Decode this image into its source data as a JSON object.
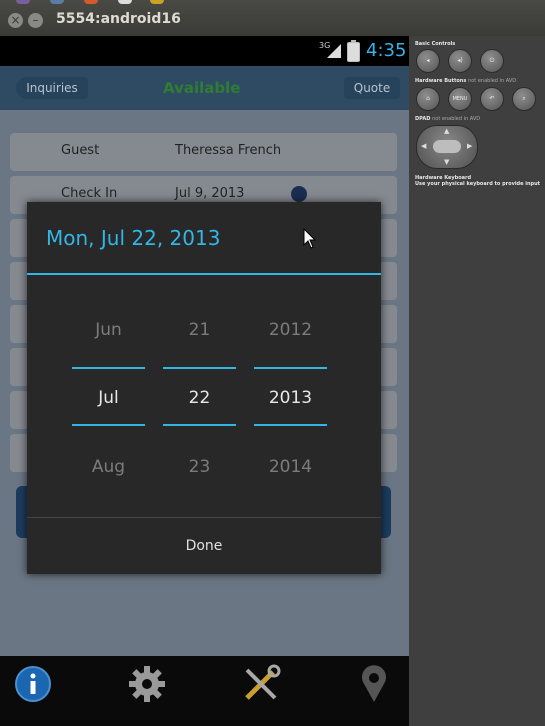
{
  "window": {
    "title": "5554:android16"
  },
  "statusbar": {
    "network": "3G",
    "time": "4:35"
  },
  "appbar": {
    "left_button": "Inquiries",
    "status": "Available",
    "right_button": "Quote"
  },
  "form_rows": [
    {
      "label": "Guest",
      "value": "Theressa French"
    },
    {
      "label": "Check In",
      "value": "Jul 9, 2013"
    }
  ],
  "date_dialog": {
    "title": "Mon, Jul 22, 2013",
    "month": {
      "prev": "Jun",
      "selected": "Jul",
      "next": "Aug"
    },
    "day": {
      "prev": "21",
      "selected": "22",
      "next": "23"
    },
    "year": {
      "prev": "2012",
      "selected": "2013",
      "next": "2014"
    },
    "done_label": "Done"
  },
  "bottom_nav": [
    "info-icon",
    "gear-icon",
    "tools-icon",
    "location-pin-icon"
  ],
  "side_panel": {
    "basic_controls": "Basic Controls",
    "hw_buttons": "Hardware Buttons",
    "hw_buttons_note": "not enabled in AVD",
    "menu_label": "MENU",
    "dpad": "DPAD",
    "dpad_note": "not enabled in AVD",
    "hw_keyboard": "Hardware Keyboard",
    "hw_keyboard_note": "Use your physical keyboard to provide input"
  },
  "colors": {
    "accent": "#33b5e5",
    "available": "#2e7d32",
    "appbar": "#2f4b64"
  }
}
